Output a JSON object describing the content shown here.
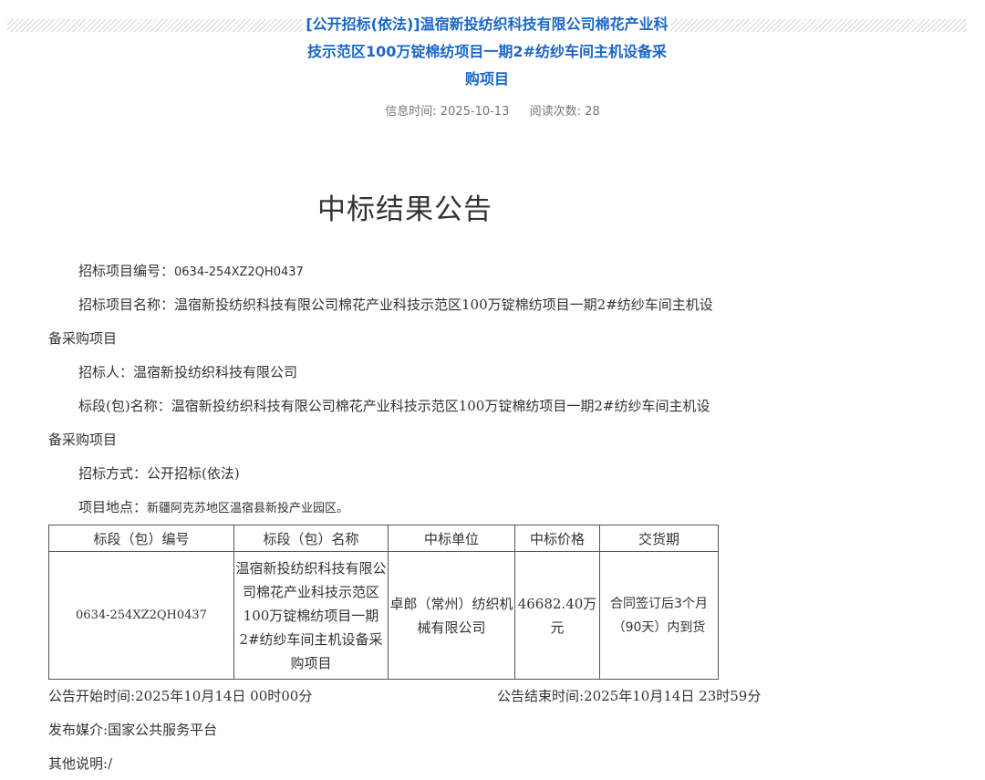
{
  "header": {
    "title": "[公开招标(依法)]温宿新投纺织科技有限公司棉花产业科技示范区100万锭棉纺项目一期2#纺纱车间主机设备采购项目",
    "info_time_label": "信息时间:",
    "info_time": "2025-10-13",
    "read_count_label": "阅读次数:",
    "read_count": "28",
    "colors": {
      "title": "#1a66c8",
      "meta": "#777777",
      "text": "#333333"
    }
  },
  "document": {
    "heading": "中标结果公告",
    "project_code_label": "招标项目编号：",
    "project_code": "0634-254XZ2QH0437",
    "project_name_label": "招标项目名称：",
    "project_name_line1": "温宿新投纺织科技有限公司棉花产业科技示范区100万锭棉纺项目一期2#纺纱车间主机设",
    "project_name_line2": "备采购项目",
    "tenderer_label": "招标人：",
    "tenderer": "温宿新投纺织科技有限公司",
    "lot_name_label": "标段(包)名称：",
    "lot_name_line1": "温宿新投纺织科技有限公司棉花产业科技示范区100万锭棉纺项目一期2#纺纱车间主机设",
    "lot_name_line2": "备采购项目",
    "method_label": "招标方式：",
    "method": "公开招标(依法)",
    "location_label": "项目地点：",
    "location": "新疆阿克苏地区温宿县新投产业园区。"
  },
  "table": {
    "headers": [
      "标段（包）编号",
      "标段（包）名称",
      "中标单位",
      "中标价格",
      "交货期"
    ],
    "rows": [
      {
        "code": "0634-254XZ2QH0437",
        "name": "温宿新投纺织科技有限公司棉花产业科技示范区100万锭棉纺项目一期2#纺纱车间主机设备采购项目",
        "winner": "卓郎（常州）纺织机械有限公司",
        "price": "46682.40万元",
        "delivery": "合同签订后3个月（90天）内到货"
      }
    ]
  },
  "footer": {
    "start_label": "公告开始时间:",
    "start": "2025年10月14日 00时00分",
    "end_label": "公告结束时间:",
    "end": "2025年10月14日 23时59分",
    "media_label": "发布媒介:",
    "media": "国家公共服务平台",
    "other_label": "其他说明:",
    "other": "/"
  }
}
